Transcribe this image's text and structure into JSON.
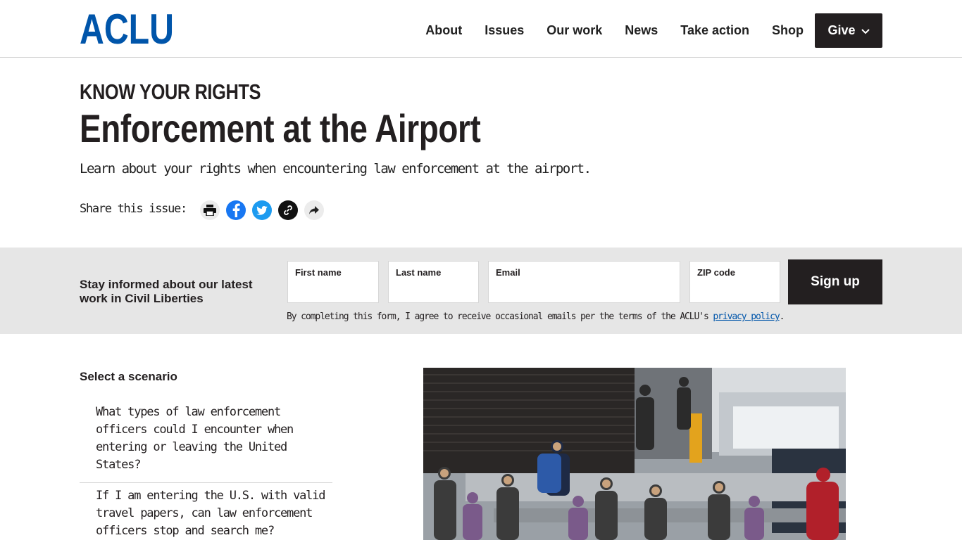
{
  "header": {
    "logo_text": "ACLU",
    "nav": [
      {
        "label": "About"
      },
      {
        "label": "Issues"
      },
      {
        "label": "Our work"
      },
      {
        "label": "News"
      },
      {
        "label": "Take action"
      },
      {
        "label": "Shop"
      }
    ],
    "give_label": "Give"
  },
  "hero": {
    "eyebrow": "KNOW YOUR RIGHTS",
    "title": "Enforcement at the Airport",
    "lede": "Learn about your rights when encountering law enforcement at the airport.",
    "share_label": "Share this issue:",
    "share_icons": [
      "print-icon",
      "facebook-icon",
      "twitter-icon",
      "link-icon",
      "share-icon"
    ]
  },
  "signup": {
    "heading": "Stay informed about our latest work in Civil Liberties",
    "first_name_label": "First name",
    "last_name_label": "Last name",
    "email_label": "Email",
    "zip_label": "ZIP code",
    "button_label": "Sign up",
    "consent_text": "By completing this form, I agree to receive occasional emails per the terms of the ACLU's ",
    "consent_link": "privacy policy",
    "consent_end": "."
  },
  "scenarios": {
    "heading": "Select a scenario",
    "items": [
      {
        "label": "What types of law enforcement officers could I encounter when entering or leaving the United States?"
      },
      {
        "label": "If I am entering the U.S. with valid travel papers, can law enforcement officers stop and search me?"
      }
    ]
  },
  "colors": {
    "brand_blue": "#0055aa",
    "dark": "#231f20",
    "band_gray": "#e6e6e6"
  }
}
